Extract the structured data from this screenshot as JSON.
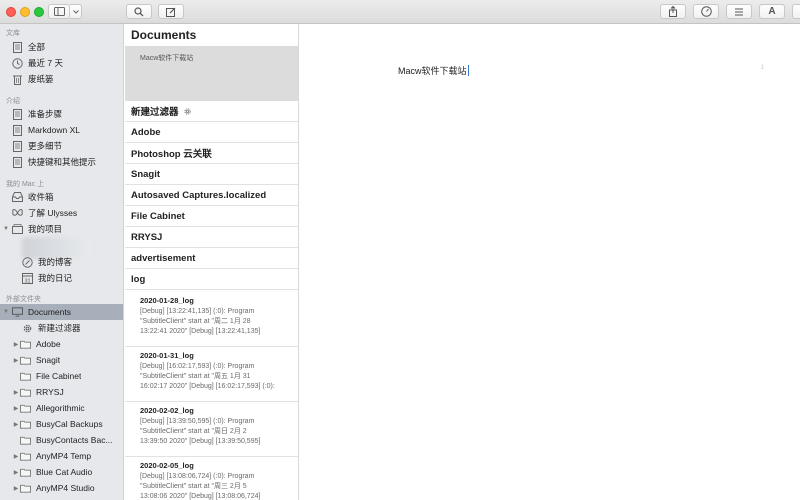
{
  "toolbar": {
    "sidebar_toggle": "sidebar-toggle",
    "dropdown": "chevron-down",
    "search": "search-icon",
    "compose": "compose-icon",
    "share": "share-icon",
    "stats": "gauge-icon",
    "attachments": "list-icon",
    "typography": "A"
  },
  "sidebar": {
    "section_library": "文库",
    "library_items": [
      {
        "label": "全部",
        "icon": "document-icon"
      },
      {
        "label": "最近 7 天",
        "icon": "clock-icon"
      },
      {
        "label": "废纸篓",
        "icon": "trash-icon"
      }
    ],
    "section_intro": "介绍",
    "intro_items": [
      {
        "label": "准备步骤",
        "icon": "document-icon"
      },
      {
        "label": "Markdown XL",
        "icon": "document-icon"
      },
      {
        "label": "更多细节",
        "icon": "document-icon"
      },
      {
        "label": "快捷键和其他提示",
        "icon": "document-icon"
      }
    ],
    "section_mac": "我的 Mac 上",
    "mac_items": [
      {
        "label": "收件箱",
        "icon": "inbox-icon"
      },
      {
        "label": "了解 Ulysses",
        "icon": "butterfly-icon"
      },
      {
        "label": "我的项目",
        "icon": "group-icon"
      },
      {
        "label": "我的博客",
        "icon": "blog-icon"
      },
      {
        "label": "我的日记",
        "icon": "calendar-icon"
      }
    ],
    "calendar_day": "31",
    "section_external": "外部文件夹",
    "external_items": [
      {
        "label": "Documents",
        "icon": "folder-icon"
      },
      {
        "label": "新建过滤器",
        "icon": "gear-icon"
      },
      {
        "label": "Adobe",
        "icon": "folder-icon"
      },
      {
        "label": "Snagit",
        "icon": "folder-icon"
      },
      {
        "label": "File Cabinet",
        "icon": "folder-icon"
      },
      {
        "label": "RRYSJ",
        "icon": "folder-icon"
      },
      {
        "label": "Allegorithmic",
        "icon": "folder-icon"
      },
      {
        "label": "BusyCal Backups",
        "icon": "folder-icon"
      },
      {
        "label": "BusyContacts Bac...",
        "icon": "folder-icon"
      },
      {
        "label": "AnyMP4 Temp",
        "icon": "folder-icon"
      },
      {
        "label": "Blue Cat Audio",
        "icon": "folder-icon"
      },
      {
        "label": "AnyMP4 Studio",
        "icon": "folder-icon"
      }
    ]
  },
  "middle": {
    "title": "Documents",
    "preview": "Macw软件下载站",
    "groups": [
      "新建过滤器",
      "Adobe",
      "Photoshop 云关联",
      "Snagit",
      "Autosaved Captures.localized",
      "File Cabinet",
      "RRYSJ",
      "advertisement",
      "log"
    ],
    "sheets": [
      {
        "title": "2020-01-28_log",
        "line1": "[Debug] [13:22:41,135] (:0): Program",
        "line2": "\"SubtitleClient\" start at \"周二 1月 28",
        "line3": "13:22:41 2020\" [Debug] [13:22:41,135]"
      },
      {
        "title": "2020-01-31_log",
        "line1": "[Debug] [16:02:17,593] (:0): Program",
        "line2": "\"SubtitleClient\" start at \"周五 1月 31",
        "line3": "16:02:17 2020\" [Debug] [16:02:17,593] (:0):"
      },
      {
        "title": "2020-02-02_log",
        "line1": "[Debug] [13:39:50,595] (:0): Program",
        "line2": "\"SubtitleClient\" start at \"周日 2月 2",
        "line3": "13:39:50 2020\" [Debug] [13:39:50,595]"
      },
      {
        "title": "2020-02-05_log",
        "line1": "[Debug] [13:08:06,724] (:0): Program",
        "line2": "\"SubtitleClient\" start at \"周三 2月 5",
        "line3": "13:08:06 2020\" [Debug] [13:08:06,724]"
      }
    ]
  },
  "editor": {
    "text": "Macw软件下载站",
    "line_number": "1"
  },
  "colors": {
    "sidebar_bg": "#e6e8eb",
    "selected_row": "#a7afba",
    "caret": "#3b7bd6",
    "preview_bg": "#dcdcdc"
  }
}
